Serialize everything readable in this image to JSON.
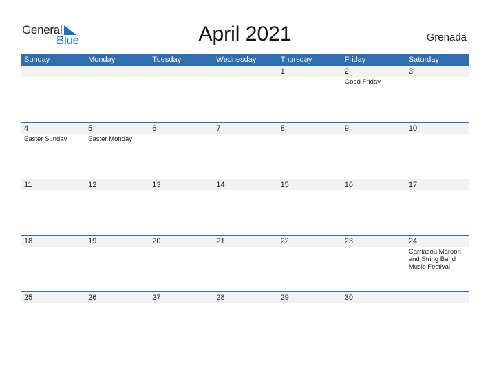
{
  "logo": {
    "part1": "General",
    "part2": "Blue"
  },
  "title": "April 2021",
  "country": "Grenada",
  "weekdays": [
    "Sunday",
    "Monday",
    "Tuesday",
    "Wednesday",
    "Thursday",
    "Friday",
    "Saturday"
  ],
  "weeks": [
    {
      "days": [
        "",
        "",
        "",
        "",
        "1",
        "2",
        "3"
      ],
      "events": [
        "",
        "",
        "",
        "",
        "",
        "Good Friday",
        ""
      ]
    },
    {
      "days": [
        "4",
        "5",
        "6",
        "7",
        "8",
        "9",
        "10"
      ],
      "events": [
        "Easter Sunday",
        "Easter Monday",
        "",
        "",
        "",
        "",
        ""
      ]
    },
    {
      "days": [
        "11",
        "12",
        "13",
        "14",
        "15",
        "16",
        "17"
      ],
      "events": [
        "",
        "",
        "",
        "",
        "",
        "",
        ""
      ]
    },
    {
      "days": [
        "18",
        "19",
        "20",
        "21",
        "22",
        "23",
        "24"
      ],
      "events": [
        "",
        "",
        "",
        "",
        "",
        "",
        "Carriacou Maroon and String Band Music Festival"
      ]
    },
    {
      "days": [
        "25",
        "26",
        "27",
        "28",
        "29",
        "30",
        ""
      ],
      "events": [
        "",
        "",
        "",
        "",
        "",
        "",
        ""
      ]
    }
  ]
}
